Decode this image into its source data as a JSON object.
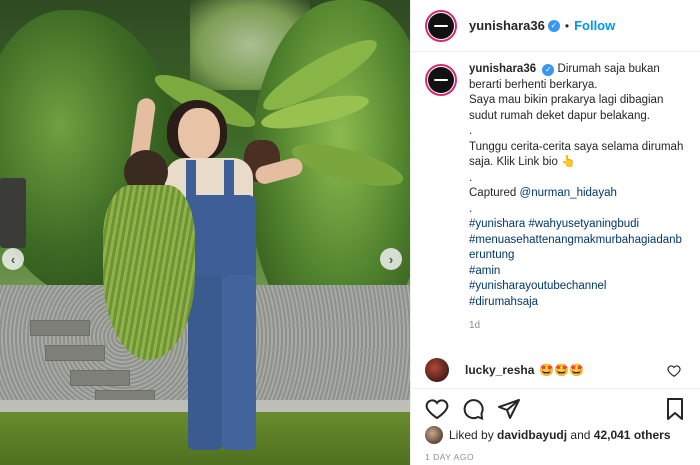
{
  "post": {
    "username": "yunishara36",
    "follow_label": "Follow",
    "separator": "•",
    "caption": {
      "username": "yunishara36",
      "line1": "Dirumah saja bukan berarti berhenti berkarya.",
      "line2": "Saya mau bikin prakarya lagi dibagian sudut rumah deket dapur belakang.",
      "dot1": ".",
      "line3": "Tunggu cerita-cerita saya selama dirumah saja. Klik Link bio",
      "emoji_point": "👆",
      "dot2": ".",
      "captured_label": "Captured",
      "captured_mention": "@nurman_hidayah",
      "dot3": ".",
      "hashtags_1": "#yunishara #wahyusetyaningbudi",
      "hashtags_2": "#menuasehattenangmakmurbahagiadanberuntung",
      "hashtags_3": "#amin",
      "hashtags_4": "#yunisharayoutubechannel",
      "hashtags_5": "#dirumahsaja",
      "time_ago": "1d"
    },
    "comment": {
      "username": "lucky_resha",
      "text": "🤩🤩🤩"
    },
    "likes": {
      "liked_by": "Liked by",
      "user": "davidbayudj",
      "and": "and",
      "count": "42,041 others"
    },
    "date": "1 DAY AGO"
  },
  "nav": {
    "prev": "‹",
    "next": "›"
  },
  "colors": {
    "accent_blue": "#0095f6",
    "hashtag": "#00376b",
    "muted": "#8e8e8e",
    "verified": "#3897f0"
  },
  "icons": [
    "verified-badge-icon",
    "heart-icon",
    "comment-icon",
    "share-icon",
    "bookmark-icon",
    "heart-small-icon",
    "prev-arrow-icon",
    "next-arrow-icon"
  ]
}
